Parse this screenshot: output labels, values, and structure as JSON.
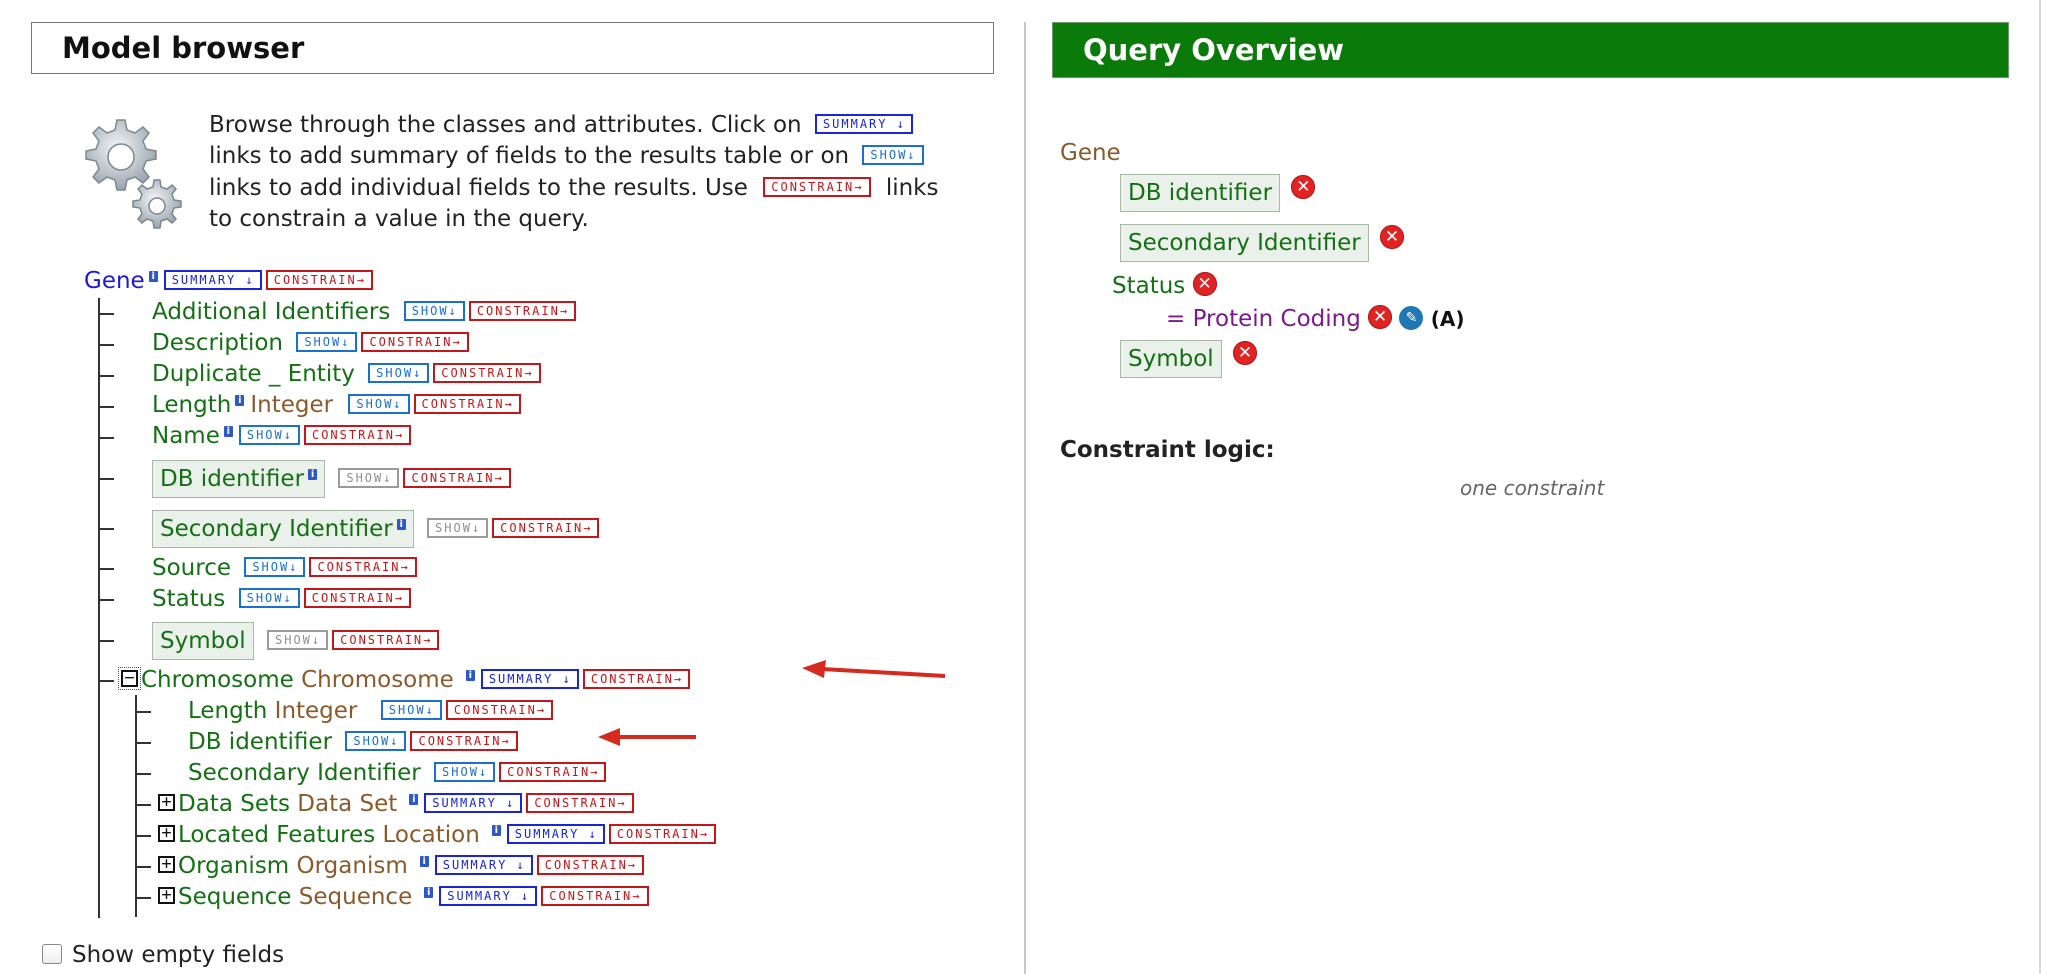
{
  "model_browser": {
    "title": "Model browser",
    "intro": {
      "line1": "Browse through the classes and attributes. Click on",
      "line2": "links to add summary of fields to the results table or on",
      "line3a": "links to add individual fields to the results. Use",
      "line3b": "links",
      "line4": "to constrain a value in the query."
    },
    "badges": {
      "summary": "SUMMARY ↓",
      "show": "SHOW↓",
      "constrain": "CONSTRAIN→"
    },
    "root": {
      "name": "Gene",
      "info": "i"
    },
    "fields": [
      {
        "name": "Additional Identifiers"
      },
      {
        "name": "Description"
      },
      {
        "name": "Duplicate _ Entity"
      },
      {
        "name": "Length",
        "type": "Integer"
      },
      {
        "name": "Name"
      },
      {
        "name": "DB identifier"
      },
      {
        "name": "Secondary Identifier"
      },
      {
        "name": "Source"
      },
      {
        "name": "Status"
      },
      {
        "name": "Symbol"
      }
    ],
    "chromosome": {
      "expander": "−",
      "name": "Chromosome",
      "type": "Chromosome",
      "children": [
        {
          "name": "Length",
          "type": "Integer"
        },
        {
          "name": "DB identifier"
        },
        {
          "name": "Secondary Identifier"
        }
      ]
    },
    "collapsed": [
      {
        "expander": "+",
        "name": "Data Sets",
        "type": "Data Set"
      },
      {
        "expander": "+",
        "name": "Located Features",
        "type": "Location"
      },
      {
        "expander": "+",
        "name": "Organism",
        "type": "Organism"
      },
      {
        "expander": "+",
        "name": "Sequence",
        "type": "Sequence"
      }
    ],
    "show_empty_fields": {
      "label": "Show empty fields",
      "checked": false
    }
  },
  "query_overview": {
    "title": "Query Overview",
    "root": "Gene",
    "views": [
      "DB identifier",
      "Secondary Identifier"
    ],
    "constraint_field": "Status",
    "constraint": {
      "op": "=",
      "value": "Protein Coding",
      "code": "(A)"
    },
    "views_after": [
      "Symbol"
    ],
    "constraint_logic_label": "Constraint logic:",
    "constraint_logic_value": "one constraint"
  },
  "colors": {
    "field_green": "#157015",
    "root_blue": "#1b1bd6",
    "type_brown": "#8b5a2b",
    "header_green": "#0a7a0a",
    "remove_red": "#e02424",
    "constraint_purple": "#7a1a8c"
  }
}
